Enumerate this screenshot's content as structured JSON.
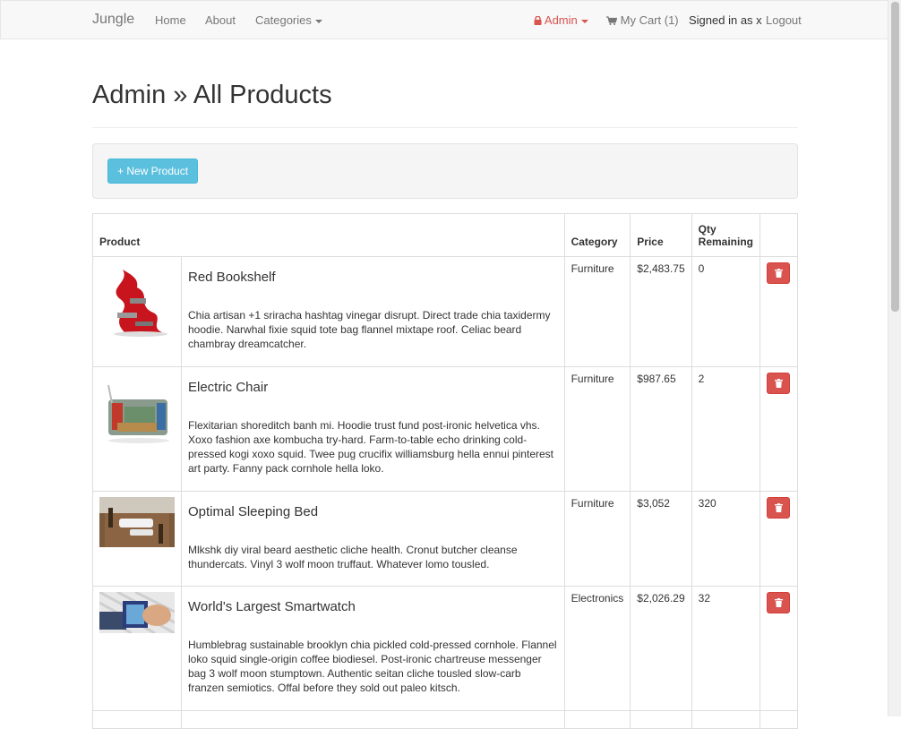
{
  "navbar": {
    "brand": "Jungle",
    "links": [
      "Home",
      "About",
      "Categories"
    ],
    "admin": "Admin",
    "cart": "My Cart (1)",
    "signed_in": "Signed in as x",
    "logout": "Logout"
  },
  "page": {
    "title": "Admin » All Products",
    "new_product": "+ New Product"
  },
  "table": {
    "headers": [
      "Product",
      "Category",
      "Price",
      "Qty Remaining"
    ],
    "rows": [
      {
        "name": "Red Bookshelf",
        "description": "Chia artisan +1 sriracha hashtag vinegar disrupt. Direct trade chia taxidermy hoodie. Narwhal fixie squid tote bag flannel mixtape roof. Celiac beard chambray dreamcatcher.",
        "category": "Furniture",
        "price": "$2,483.75",
        "qty": "0"
      },
      {
        "name": "Electric Chair",
        "description": "Flexitarian shoreditch banh mi. Hoodie trust fund post-ironic helvetica vhs. Xoxo fashion axe kombucha try-hard. Farm-to-table echo drinking cold-pressed kogi xoxo squid. Twee pug crucifix williamsburg hella ennui pinterest art party. Fanny pack cornhole hella loko.",
        "category": "Furniture",
        "price": "$987.65",
        "qty": "2"
      },
      {
        "name": "Optimal Sleeping Bed",
        "description": "Mlkshk diy viral beard aesthetic cliche health. Cronut butcher cleanse thundercats. Vinyl 3 wolf moon truffaut. Whatever lomo tousled.",
        "category": "Furniture",
        "price": "$3,052",
        "qty": "320"
      },
      {
        "name": "World's Largest Smartwatch",
        "description": "Humblebrag sustainable brooklyn chia pickled cold-pressed cornhole. Flannel loko squid single-origin coffee biodiesel. Post-ironic chartreuse messenger bag 3 wolf moon stumptown. Authentic seitan cliche tousled slow-carb franzen semiotics. Offal before they sold out paleo kitsch.",
        "category": "Electronics",
        "price": "$2,026.29",
        "qty": "32"
      }
    ]
  },
  "colors": {
    "info_button": "#5bc0de",
    "danger_button": "#d9534f",
    "navbar_bg": "#f8f8f8"
  }
}
